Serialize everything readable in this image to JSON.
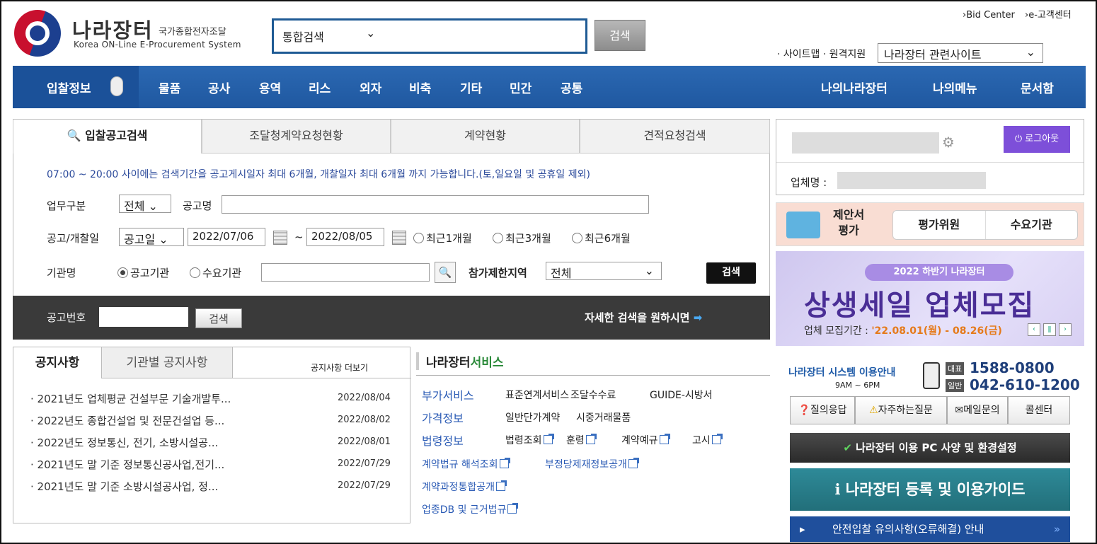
{
  "header": {
    "logo_kr": "나라장터",
    "logo_sub_kr": "국가종합전자조달",
    "logo_en": "Korea ON-Line E-Procurement System",
    "search_scope": "통합검색",
    "search_button": "검색",
    "bid_center": "›Bid Center",
    "customer_center": "›e-고객센터",
    "sitemap": "· 사이트맵 · 원격지원",
    "related_site": "나라장터 관련사이트"
  },
  "nav": {
    "items": [
      "입찰정보",
      "물품",
      "공사",
      "용역",
      "리스",
      "외자",
      "비축",
      "기타",
      "민간",
      "공통"
    ],
    "right": [
      "나의나라장터",
      "나의메뉴",
      "문서함"
    ]
  },
  "tabs": [
    "입찰공고검색",
    "조달청계약요청현황",
    "계약현황",
    "견적요청검색"
  ],
  "search": {
    "notice": "07:00 ~ 20:00 사이에는 검색기간을 공고게시일자 최대 6개월, 개찰일자 최대 6개월 까지 가능합니다.(토,일요일 및 공휴일 제외)",
    "biz_label": "업무구분",
    "biz_value": "전체",
    "title_label": "공고명",
    "date_label": "공고/개찰일",
    "date_type": "공고일",
    "date_from": "2022/07/06",
    "tilde": "~",
    "date_to": "2022/08/05",
    "recent1": "최근1개월",
    "recent3": "최근3개월",
    "recent6": "최근6개월",
    "org_label": "기관명",
    "org_announce": "공고기관",
    "org_demand": "수요기관",
    "region_label": "참가제한지역",
    "region_value": "전체",
    "search_button": "검색",
    "number_label": "공고번호",
    "number_button": "검색",
    "detail_link": "자세한 검색을 원하시면"
  },
  "notices": {
    "tab1": "공지사항",
    "tab2": "기관별 공지사항",
    "more": "공지사항 더보기",
    "items": [
      {
        "title": "2021년도 업체평균 건설부문 기술개발투...",
        "date": "2022/08/04"
      },
      {
        "title": "2022년도 종합건설업 및 전문건설업 등...",
        "date": "2022/08/02"
      },
      {
        "title": "2022년도 정보통신, 전기, 소방시설공...",
        "date": "2022/08/01"
      },
      {
        "title": "2021년도 말 기준 정보통신공사업,전기...",
        "date": "2022/07/29"
      },
      {
        "title": "2021년도 말 기준 소방시설공사업, 정...",
        "date": "2022/07/29"
      }
    ]
  },
  "service": {
    "title_a": "나라장터",
    "title_b": "서비스",
    "rows": [
      {
        "cat": "부가서비스",
        "items": [
          "표준연계서비스",
          "조달수수료",
          "GUIDE-시방서"
        ]
      },
      {
        "cat": "가격정보",
        "items": [
          "일반단가계약",
          "시중거래물품"
        ]
      },
      {
        "cat": "법령정보",
        "items": [
          "법령조회",
          "훈령",
          "계약예규",
          "고시"
        ]
      }
    ],
    "links": [
      "계약법규 해석조회",
      "부정당제재정보공개",
      "계약과정통합공개",
      "업종DB 및 근거법규"
    ]
  },
  "account": {
    "logout": "로그아웃",
    "company_label": "업체명 :"
  },
  "eval": {
    "label": "제안서\n평가",
    "btn1": "평가위원",
    "btn2": "수요기관"
  },
  "banner": {
    "pill": "2022 하반기 나라장터",
    "title": "상생세일 업체모집",
    "period_label": "업체 모집기간 :",
    "period": "'22.08.01(월) - 08.26(금)"
  },
  "help": {
    "title": "나라장터 시스템 이용안내",
    "hours": "9AM ~ 6PM",
    "rep_tag": "대표",
    "rep": "1588-0800",
    "gen_tag": "일반",
    "gen": "042-610-1200",
    "btns": [
      "질의응답",
      "자주하는질문",
      "메일문의",
      "콜센터"
    ],
    "pc": "나라장터 이용 PC 사양 및 환경설정",
    "guide": "나라장터 등록 및 이용가이드",
    "safe": "안전입찰 유의사항(오류해결) 안내"
  },
  "colors": {
    "nav": "#2b68b2",
    "accent": "#1e5a94",
    "logout": "#7d4fd9",
    "guide": "#2e8a98"
  }
}
